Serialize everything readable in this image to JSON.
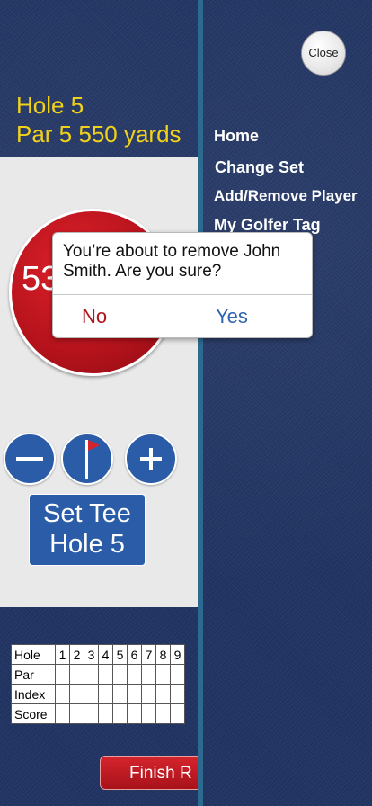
{
  "hole": {
    "title": "Hole 5",
    "par_line": "Par 5  550 yards"
  },
  "distance": {
    "value": "53"
  },
  "controls": {
    "minus_icon": "minus-icon",
    "flag_icon": "pin-flag-icon",
    "plus_icon": "plus-icon",
    "set_tee_line1": "Set Tee",
    "set_tee_line2": "Hole 5"
  },
  "scorecard": {
    "rows": [
      "Hole",
      "Par",
      "Index",
      "Score"
    ],
    "holes": [
      "1",
      "2",
      "3",
      "4",
      "5",
      "6",
      "7",
      "8",
      "9"
    ]
  },
  "finish_label": "Finish R",
  "menu": {
    "close_label": "Close",
    "items": [
      "Home",
      "Change Set",
      "Add/Remove Player",
      "My Golfer Tag"
    ]
  },
  "alert": {
    "message": "You’re about to remove John Smith. Are you sure?",
    "no_label": "No",
    "yes_label": "Yes"
  },
  "colors": {
    "accent_yellow": "#f1d21a",
    "button_blue": "#2a5ca8",
    "red": "#c8161f",
    "yes_blue": "#2f63b4",
    "no_red": "#b0141c"
  }
}
